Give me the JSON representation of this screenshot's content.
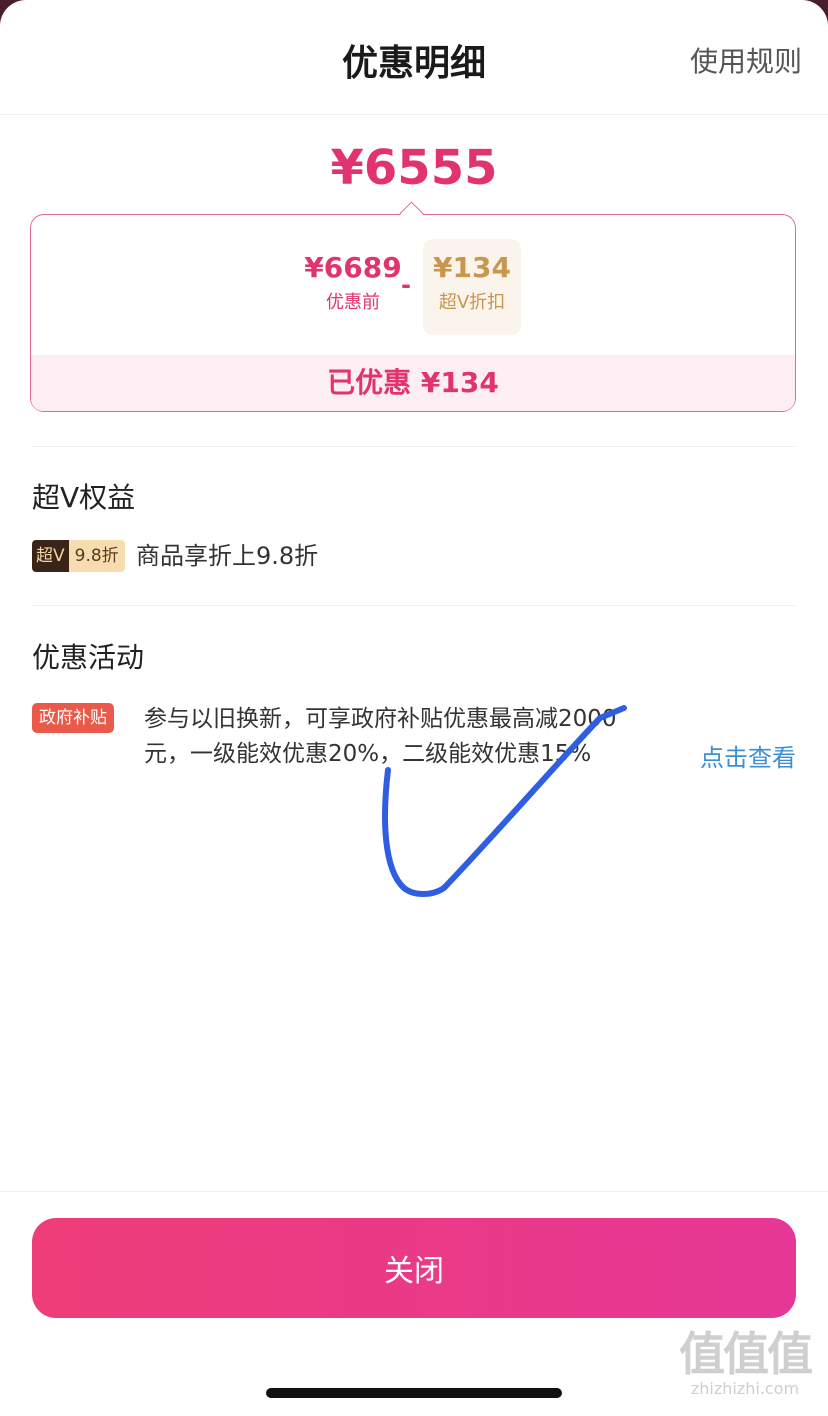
{
  "header": {
    "title": "优惠明细",
    "rules_link": "使用规则"
  },
  "price": {
    "total": "¥6555"
  },
  "breakdown": {
    "before_amount": "¥6689",
    "before_label": "优惠前",
    "operator": "-",
    "discount_amount": "¥134",
    "discount_label": "超V折扣",
    "saved_text": "已优惠 ¥134"
  },
  "svip_section": {
    "title": "超V权益",
    "tag_left": "超V",
    "tag_right": "9.8折",
    "description": "商品享折上9.8折"
  },
  "promo_section": {
    "title": "优惠活动",
    "tag": "政府补贴",
    "description": "参与以旧换新，可享政府补贴优惠最高减2000元，一级能效优惠20%，二级能效优惠15%",
    "link": "点击查看"
  },
  "footer": {
    "close_label": "关闭"
  },
  "watermark": {
    "glyphs": "值值值",
    "url": "zhizhizhi.com"
  },
  "colors": {
    "accent": "#e0336f",
    "link": "#3b8fd6",
    "gov_tag": "#ea5a4a",
    "annotation": "#2f5fe0"
  }
}
